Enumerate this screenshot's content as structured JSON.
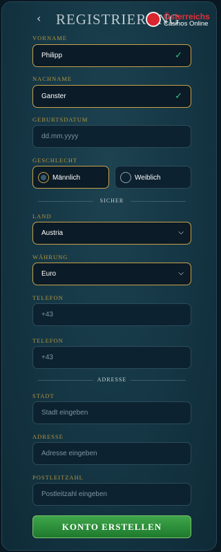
{
  "header": {
    "back_icon": "chevron-left-icon",
    "title": "Registrierung",
    "logo": {
      "line1": "Österreichs",
      "line2": "Casinos Online"
    }
  },
  "form": {
    "vorname": {
      "label": "Vorname",
      "value": "Philipp"
    },
    "nachname": {
      "label": "Nachname",
      "value": "Ganster"
    },
    "geburtsdatum": {
      "label": "Geburtsdatum",
      "placeholder": "dd.mm.yyyy"
    },
    "geschlecht": {
      "label": "Geschlecht",
      "options": [
        "Männlich",
        "Weiblich"
      ],
      "selected": "Männlich"
    },
    "section_sicher": "Sicher",
    "land": {
      "label": "Land",
      "value": "Austria"
    },
    "waehrung": {
      "label": "Währung",
      "value": "Euro"
    },
    "telefon1": {
      "label": "Telefon",
      "placeholder": "+43"
    },
    "telefon2": {
      "label": "Telefon",
      "placeholder": "+43"
    },
    "section_adresse": "Adresse",
    "stadt": {
      "label": "Stadt",
      "placeholder": "Stadt eingeben"
    },
    "adresse": {
      "label": "Adresse",
      "placeholder": "Adresse eingeben"
    },
    "postleitzahl": {
      "label": "Postleitzahl",
      "placeholder": "Postleitzahl eingeben"
    },
    "submit_label": "Konto erstellen"
  },
  "colors": {
    "accent_gold": "#c9a24b",
    "valid_green": "#36c489",
    "button_green": "#2e9a3f"
  }
}
